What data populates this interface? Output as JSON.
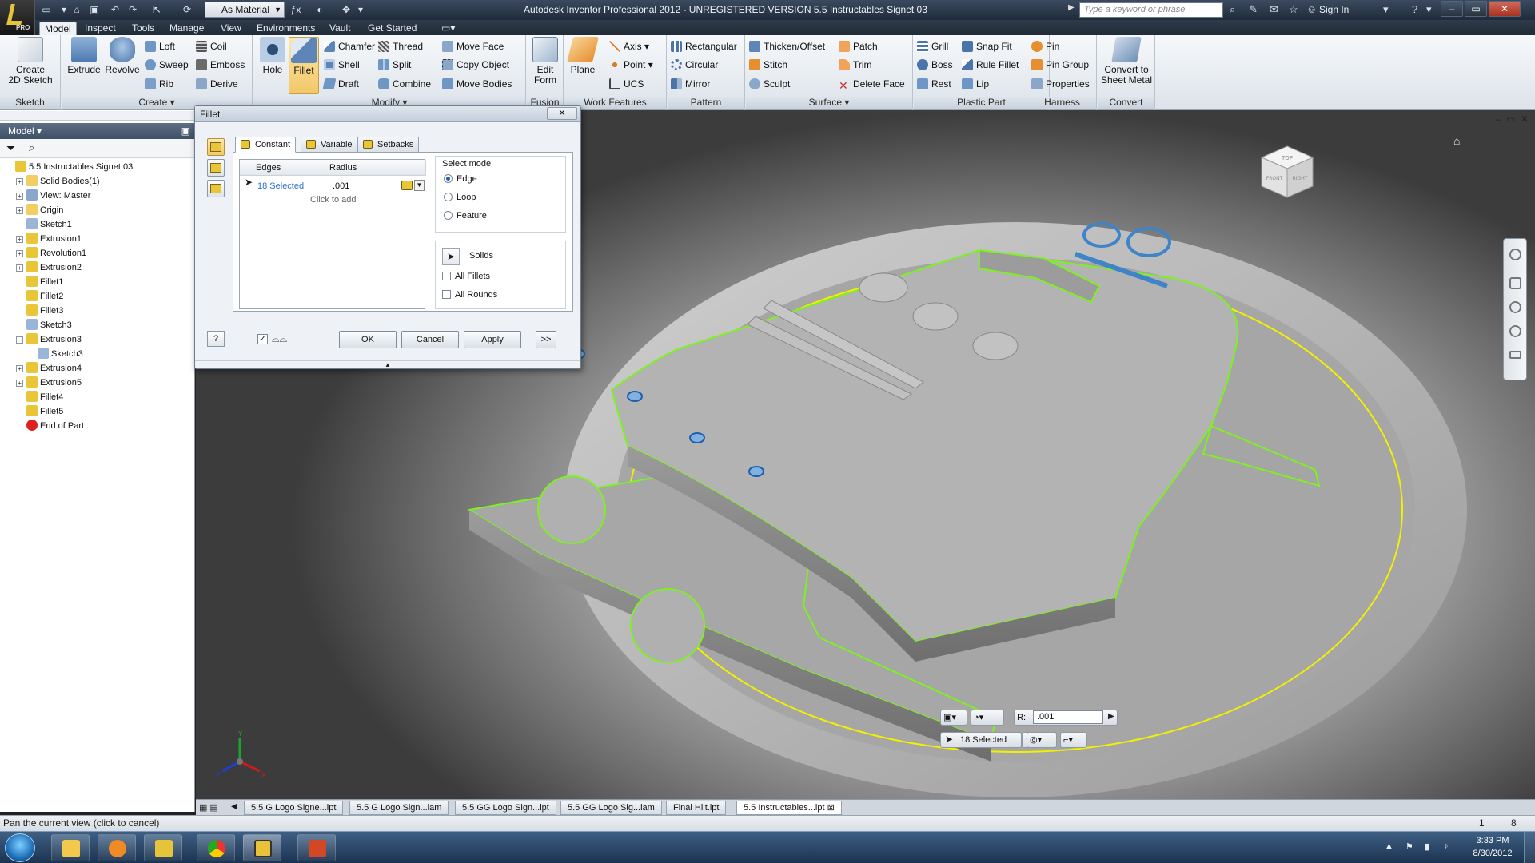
{
  "titlebar": {
    "title": "Autodesk Inventor Professional 2012 - UNREGISTERED VERSION   5.5 Instructables Signet 03",
    "material": "As Material",
    "search_placeholder": "Type a keyword or phrase",
    "sign_in": "Sign In",
    "app_badge": "PRO"
  },
  "ribbon_tabs": [
    "Model",
    "Inspect",
    "Tools",
    "Manage",
    "View",
    "Environments",
    "Vault",
    "Get Started"
  ],
  "ribbon": {
    "sketch": {
      "label": "Sketch",
      "create_2d_sketch": "Create\n2D Sketch"
    },
    "create": {
      "label": "Create ▾",
      "extrude": "Extrude",
      "revolve": "Revolve",
      "loft": "Loft",
      "sweep": "Sweep",
      "rib": "Rib",
      "coil": "Coil",
      "emboss": "Emboss",
      "derive": "Derive"
    },
    "modify": {
      "label": "Modify ▾",
      "hole": "Hole",
      "fillet": "Fillet",
      "chamfer": "Chamfer",
      "shell": "Shell",
      "draft": "Draft",
      "thread": "Thread",
      "split": "Split",
      "combine": "Combine",
      "move_face": "Move Face",
      "copy_object": "Copy Object",
      "move_bodies": "Move Bodies"
    },
    "fusion": {
      "label": "Fusion",
      "edit_form": "Edit\nForm"
    },
    "work_features": {
      "label": "Work Features",
      "plane": "Plane",
      "axis": "Axis",
      "point": "Point",
      "ucs": "UCS"
    },
    "pattern": {
      "label": "Pattern",
      "rectangular": "Rectangular",
      "circular": "Circular",
      "mirror": "Mirror"
    },
    "surface": {
      "label": "Surface ▾",
      "thicken_offset": "Thicken/Offset",
      "stitch": "Stitch",
      "sculpt": "Sculpt",
      "patch": "Patch",
      "trim": "Trim",
      "delete_face": "Delete Face"
    },
    "plastic_part": {
      "label": "Plastic Part",
      "grill": "Grill",
      "boss": "Boss",
      "rest": "Rest",
      "snap_fit": "Snap Fit",
      "rule_fillet": "Rule Fillet",
      "lip": "Lip"
    },
    "harness": {
      "label": "Harness",
      "pin": "Pin",
      "pin_group": "Pin Group",
      "properties": "Properties"
    },
    "convert": {
      "label": "Convert",
      "convert_to_sheet_metal": "Convert to\nSheet Metal"
    }
  },
  "browser": {
    "header": "Model ▾",
    "tree": [
      {
        "label": "5.5 Instructables Signet 03",
        "indent": 0,
        "expander": "",
        "icon": "part"
      },
      {
        "label": "Solid Bodies(1)",
        "indent": 1,
        "expander": "+",
        "icon": "folder"
      },
      {
        "label": "View: Master",
        "indent": 1,
        "expander": "+",
        "icon": "view"
      },
      {
        "label": "Origin",
        "indent": 1,
        "expander": "+",
        "icon": "folder"
      },
      {
        "label": "Sketch1",
        "indent": 1,
        "expander": "",
        "icon": "sketch"
      },
      {
        "label": "Extrusion1",
        "indent": 1,
        "expander": "+",
        "icon": "extrude"
      },
      {
        "label": "Revolution1",
        "indent": 1,
        "expander": "+",
        "icon": "revolve"
      },
      {
        "label": "Extrusion2",
        "indent": 1,
        "expander": "+",
        "icon": "extrude"
      },
      {
        "label": "Fillet1",
        "indent": 1,
        "expander": "",
        "icon": "fillet"
      },
      {
        "label": "Fillet2",
        "indent": 1,
        "expander": "",
        "icon": "fillet"
      },
      {
        "label": "Fillet3",
        "indent": 1,
        "expander": "",
        "icon": "fillet"
      },
      {
        "label": "Sketch3",
        "indent": 1,
        "expander": "",
        "icon": "sketch"
      },
      {
        "label": "Extrusion3",
        "indent": 1,
        "expander": "-",
        "icon": "extrude"
      },
      {
        "label": "Sketch3",
        "indent": 2,
        "expander": "",
        "icon": "sketch"
      },
      {
        "label": "Extrusion4",
        "indent": 1,
        "expander": "+",
        "icon": "extrude"
      },
      {
        "label": "Extrusion5",
        "indent": 1,
        "expander": "+",
        "icon": "extrude"
      },
      {
        "label": "Fillet4",
        "indent": 1,
        "expander": "",
        "icon": "fillet"
      },
      {
        "label": "Fillet5",
        "indent": 1,
        "expander": "",
        "icon": "fillet"
      },
      {
        "label": "End of Part",
        "indent": 1,
        "expander": "",
        "icon": "end-of-part"
      }
    ]
  },
  "fillet_dialog": {
    "title": "Fillet",
    "tabs": [
      "Constant",
      "Variable",
      "Setbacks"
    ],
    "grid": {
      "col_edges": "Edges",
      "col_radius": "Radius",
      "row_selected": "18 Selected",
      "row_radius": ".001",
      "click_to_add": "Click to add"
    },
    "select_mode": {
      "label": "Select mode",
      "options": [
        "Edge",
        "Loop",
        "Feature"
      ],
      "selected": "Edge"
    },
    "solids": "Solids",
    "checkboxes": [
      "All Fillets",
      "All Rounds"
    ],
    "buttons": {
      "ok": "OK",
      "cancel": "Cancel",
      "apply": "Apply",
      "more": ">>"
    }
  },
  "viewcube": {
    "top": "TOP",
    "front": "FRONT",
    "right": "RIGHT"
  },
  "mini_toolbar": {
    "radius_label": "R:",
    "radius_value": ".001",
    "selected": "18 Selected"
  },
  "triad": {
    "x": "X",
    "y": "Y",
    "z": "Z"
  },
  "doc_tabs": [
    "5.5 G Logo Signe...ipt",
    "5.5 G Logo Sign...iam",
    "5.5 GG Logo Sign...ipt",
    "5.5 GG Logo Sig...iam",
    "Final Hilt.ipt",
    "5.5 Instructables...ipt"
  ],
  "status": {
    "text": "Pan the current view (click to cancel)",
    "n1": "1",
    "n2": "8"
  },
  "taskbar": {
    "time": "3:33 PM",
    "date": "8/30/2012"
  },
  "colors": {
    "accent": "#f3c76a",
    "highlight_green": "#7cf21e",
    "highlight_yellow": "#f3f000",
    "selection_blue": "#2d73c9"
  }
}
